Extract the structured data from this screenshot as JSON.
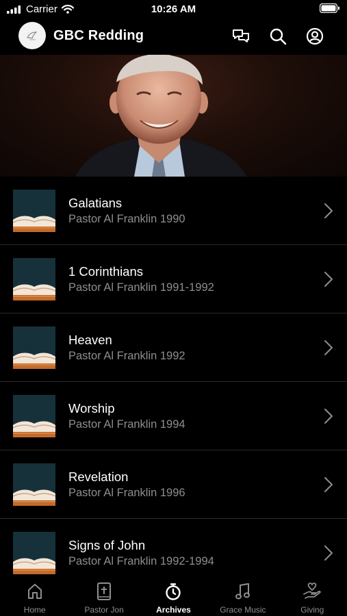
{
  "status_bar": {
    "carrier": "Carrier",
    "time": "10:26 AM"
  },
  "header": {
    "title": "GBC Redding"
  },
  "sermons": [
    {
      "title": "Galatians",
      "subtitle": "Pastor Al Franklin 1990"
    },
    {
      "title": "1 Corinthians",
      "subtitle": "Pastor Al Franklin 1991-1992"
    },
    {
      "title": "Heaven",
      "subtitle": "Pastor Al Franklin 1992"
    },
    {
      "title": "Worship",
      "subtitle": "Pastor Al Franklin 1994"
    },
    {
      "title": "Revelation",
      "subtitle": "Pastor Al Franklin 1996"
    },
    {
      "title": "Signs of John",
      "subtitle": "Pastor Al Franklin 1992-1994"
    }
  ],
  "tabs": [
    {
      "label": "Home",
      "icon": "home-icon",
      "active": false
    },
    {
      "label": "Pastor Jon",
      "icon": "bible-icon",
      "active": false
    },
    {
      "label": "Archives",
      "icon": "stopwatch-icon",
      "active": true
    },
    {
      "label": "Grace Music",
      "icon": "music-note-icon",
      "active": false
    },
    {
      "label": "Giving",
      "icon": "giving-hand-icon",
      "active": false
    }
  ],
  "colors": {
    "background": "#000000",
    "text": "#ffffff",
    "secondary_text": "#8e8e93",
    "separator": "#2a2a2a"
  }
}
